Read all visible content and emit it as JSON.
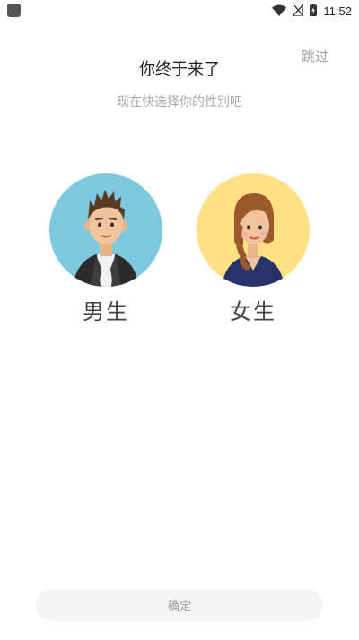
{
  "status_bar": {
    "time": "11:52",
    "icons": [
      "app-indicator-icon",
      "wifi-icon",
      "no-signal-icon",
      "battery-charging-icon"
    ]
  },
  "header": {
    "skip_label": "跳过",
    "title": "你终于来了",
    "subtitle": "现在快选择你的性别吧"
  },
  "options": {
    "male": {
      "label": "男生",
      "avatar_bg": "#7ec8dd",
      "icon": "male-avatar-icon"
    },
    "female": {
      "label": "女生",
      "avatar_bg": "#fde184",
      "icon": "female-avatar-icon"
    }
  },
  "footer": {
    "confirm_label": "确定"
  },
  "colors": {
    "background": "#ffffff",
    "title_text": "#222222",
    "muted_text": "#a8a8a8",
    "button_bg": "#f5f5f5"
  }
}
